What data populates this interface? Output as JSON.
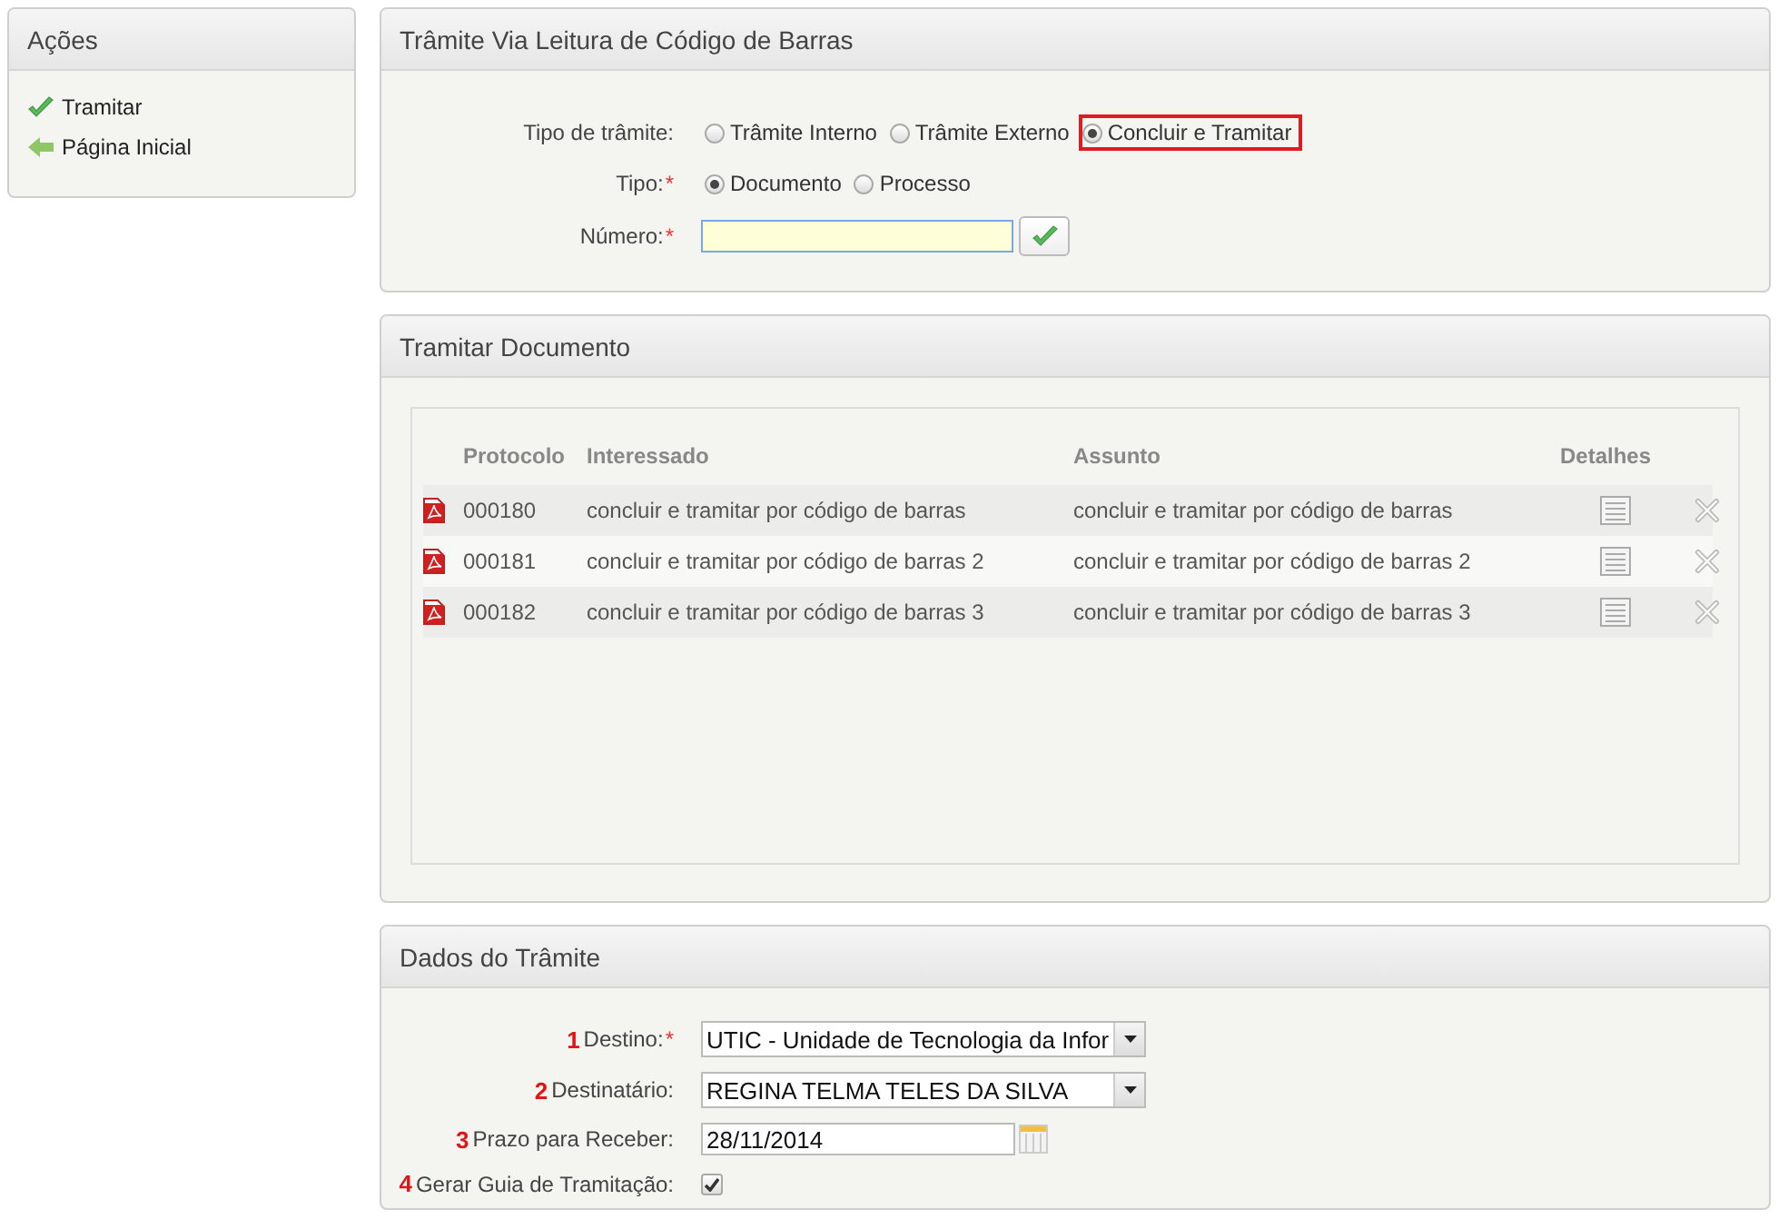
{
  "sidebar": {
    "title": "Ações",
    "items": [
      {
        "label": "Tramitar",
        "kind": "check"
      },
      {
        "label": "Página Inicial",
        "kind": "back"
      }
    ]
  },
  "barcode_panel": {
    "title": "Trâmite Via Leitura de Código de Barras",
    "fields": [
      {
        "label": "Tipo de trâmite:",
        "kind": "radio",
        "options": [
          {
            "label": "Trâmite Interno",
            "selected": false,
            "highlighted": false
          },
          {
            "label": "Trâmite Externo",
            "selected": false,
            "highlighted": false
          },
          {
            "label": "Concluir e Tramitar",
            "selected": true,
            "highlighted": true
          }
        ]
      },
      {
        "label": "Tipo:",
        "required_mark": "*",
        "kind": "radio",
        "options": [
          {
            "label": "Documento",
            "selected": true,
            "highlighted": false
          },
          {
            "label": "Processo",
            "selected": false,
            "highlighted": false
          }
        ]
      },
      {
        "label": "Número:",
        "required_mark": "*",
        "kind": "text",
        "focused": true
      }
    ]
  },
  "documents_panel": {
    "title": "Tramitar Documento",
    "table": {
      "columns": [
        "Protocolo",
        "Interessado",
        "Assunto",
        "Detalhes"
      ],
      "rows": [
        {
          "protocolo": "000180",
          "interessado": "concluir e tramitar por código de barras",
          "assunto": "concluir e tramitar por código de barras"
        },
        {
          "protocolo": "000181",
          "interessado": "concluir e tramitar por código de barras 2",
          "assunto": "concluir e tramitar por código de barras 2"
        },
        {
          "protocolo": "000182",
          "interessado": "concluir e tramitar por código de barras 3",
          "assunto": "concluir e tramitar por código de barras 3"
        }
      ]
    }
  },
  "dispatch_panel": {
    "title": "Dados do Trâmite",
    "fields": [
      {
        "marker": "1",
        "label": "Destino:",
        "required_mark": "*",
        "kind": "select",
        "value": "UTIC - Unidade de Tecnologia da Infor"
      },
      {
        "marker": "2",
        "label": "Destinatário:",
        "kind": "select",
        "value": "REGINA TELMA TELES DA SILVA"
      },
      {
        "marker": "3",
        "label": "Prazo para Receber:",
        "kind": "date",
        "value": "28/11/2014"
      },
      {
        "marker": "4",
        "label": "Gerar Guia de Tramitação:",
        "kind": "checkbox",
        "checked": true
      }
    ]
  }
}
